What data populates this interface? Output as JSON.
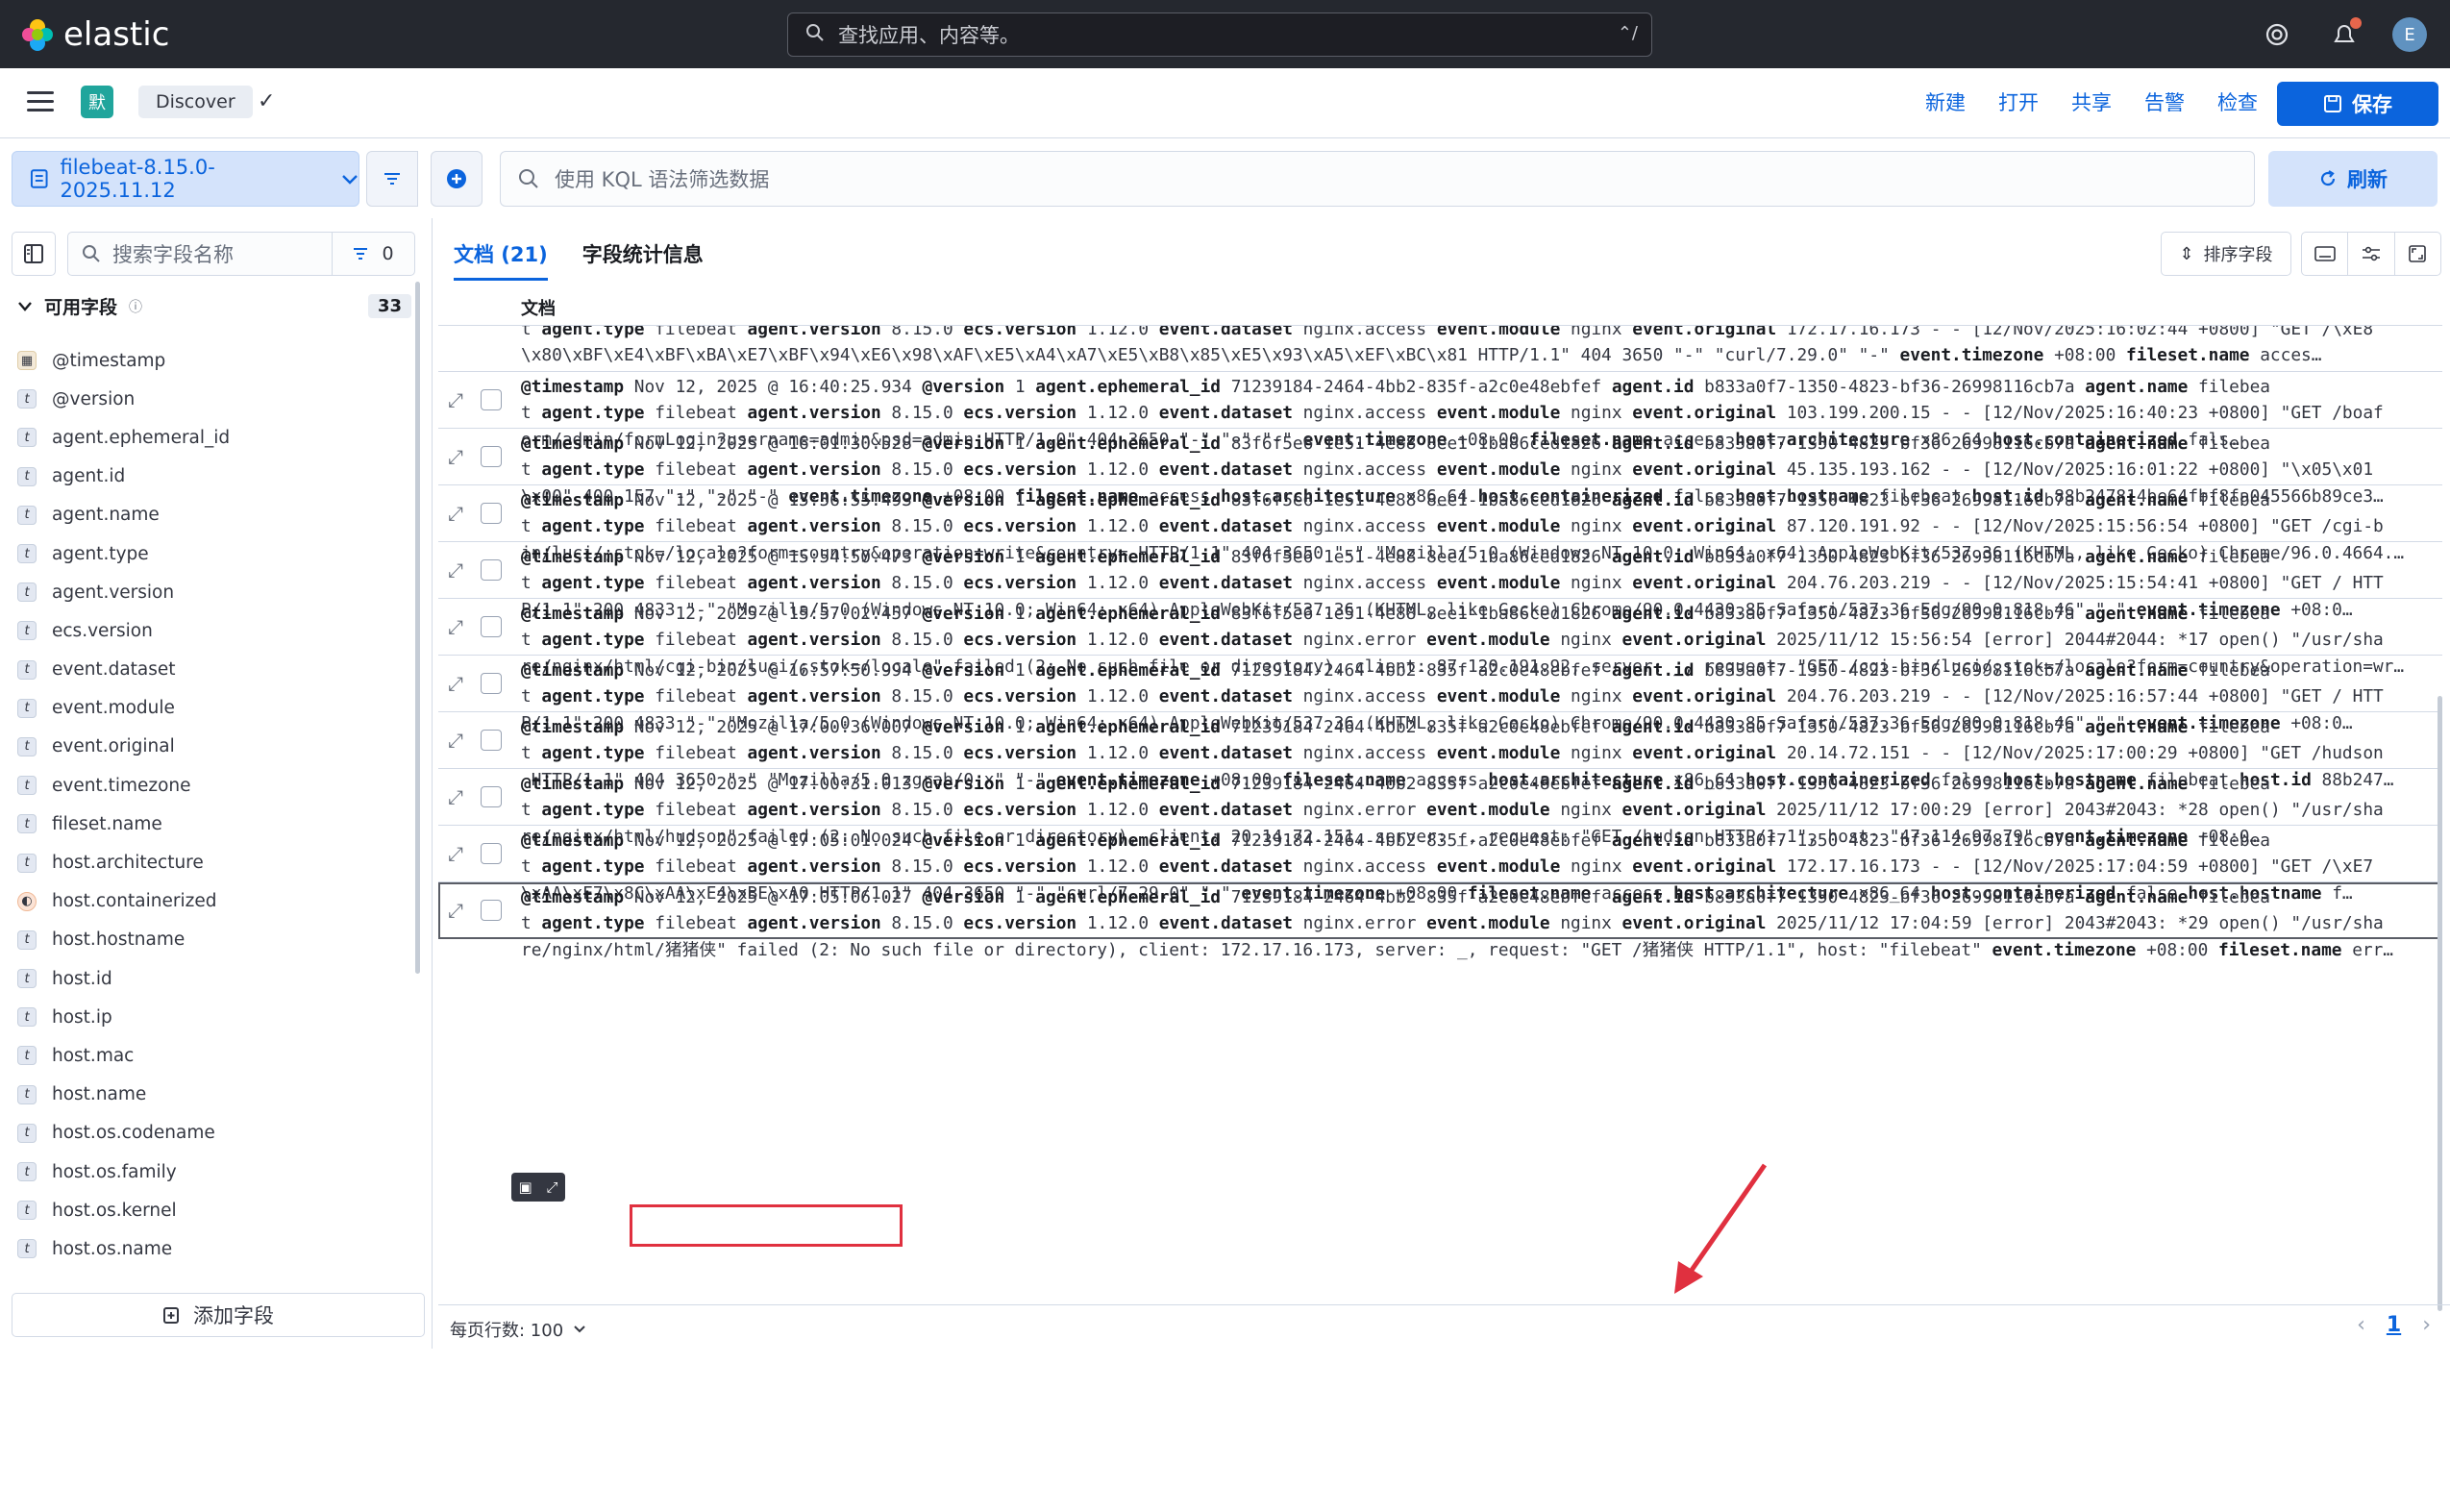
{
  "app": {
    "brand": "elastic",
    "search_placeholder": "查找应用、内容等。",
    "search_shortcut": "⌃/",
    "user_initial": "E"
  },
  "nav": {
    "space_initial": "默",
    "breadcrumb": "Discover",
    "links": [
      "新建",
      "打开",
      "共享",
      "告警",
      "检查"
    ],
    "save_label": "保存"
  },
  "toolbar": {
    "data_view": "filebeat-8.15.0-2025.11.12",
    "kql_placeholder": "使用 KQL 语法筛选数据",
    "refresh_label": "刷新"
  },
  "sidebar": {
    "search_placeholder": "搜索字段名称",
    "filter_count": "0",
    "available_label": "可用字段",
    "available_count": "33",
    "add_field_label": "添加字段",
    "fields": [
      {
        "name": "@timestamp",
        "type": "date"
      },
      {
        "name": "@version",
        "type": "t"
      },
      {
        "name": "agent.ephemeral_id",
        "type": "t"
      },
      {
        "name": "agent.id",
        "type": "t"
      },
      {
        "name": "agent.name",
        "type": "t"
      },
      {
        "name": "agent.type",
        "type": "t"
      },
      {
        "name": "agent.version",
        "type": "t"
      },
      {
        "name": "ecs.version",
        "type": "t"
      },
      {
        "name": "event.dataset",
        "type": "t"
      },
      {
        "name": "event.module",
        "type": "t"
      },
      {
        "name": "event.original",
        "type": "t"
      },
      {
        "name": "event.timezone",
        "type": "t"
      },
      {
        "name": "fileset.name",
        "type": "t"
      },
      {
        "name": "host.architecture",
        "type": "t"
      },
      {
        "name": "host.containerized",
        "type": "bool"
      },
      {
        "name": "host.hostname",
        "type": "t"
      },
      {
        "name": "host.id",
        "type": "t"
      },
      {
        "name": "host.ip",
        "type": "t"
      },
      {
        "name": "host.mac",
        "type": "t"
      },
      {
        "name": "host.name",
        "type": "t"
      },
      {
        "name": "host.os.codename",
        "type": "t"
      },
      {
        "name": "host.os.family",
        "type": "t"
      },
      {
        "name": "host.os.kernel",
        "type": "t"
      },
      {
        "name": "host.os.name",
        "type": "t"
      }
    ]
  },
  "main": {
    "tabs": [
      "文档 (21)",
      "字段统计信息"
    ],
    "sort_label": "排序字段",
    "column_header": "文档",
    "rows_per_page": "每页行数: 100",
    "current_page": "1",
    "partial_row": [
      "t agent.type filebeat agent.version 8.15.0 ecs.version 1.12.0 event.dataset nginx.access event.module nginx event.original 172.17.16.173 - - [12/Nov/2025:16:02:44 +0800] \"GET /\\xE8",
      "\\x80\\xBF\\xE4\\xBF\\xBA\\xE7\\xBF\\x94\\xE6\\x98\\xAF\\xE5\\xA4\\xA7\\xE5\\xB8\\x85\\xE5\\x93\\xA5\\xEF\\xBC\\x81 HTTP/1.1\" 404 3650 \"-\" \"curl/7.29.0\" \"-\" event.timezone +08:00 fileset.name acces…"
    ],
    "rows": [
      {
        "ts": "Nov 12, 2025 @ 16:40:25.934",
        "eph": "71239184-2464-4bb2-835f-a2c0e48ebfef",
        "ds": "nginx.access",
        "l2": "103.199.200.15 - - [12/Nov/2025:16:40:23 +0800] \"GET /boaf",
        "l3": "orm/admin/formLogin?username=admin&psd=admin HTTP/1.0\" 404 3650 \"-\" \"-\" \"-\" event.timezone +08:00 fileset.name access host.architecture x86_64 host.containerized fals…"
      },
      {
        "ts": "Nov 12, 2025 @ 16:01:30.528",
        "eph": "83f6f5e6-1e51-4e88-8ee1-1ba86ced1826",
        "ds": "nginx.access",
        "l2": "45.135.193.162 - - [12/Nov/2025:16:01:22 +0800] \"\\x05\\x01",
        "l3": "\\x00\" 400 157 \"-\" \"-\" \"-\" event.timezone +08:00 fileset.name access host.architecture x86_64 host.containerized false host.hostname filebeat host.id 88b247814be64fbf8fa045566b89ce3…"
      },
      {
        "ts": "Nov 12, 2025 @ 15:56:55.493",
        "eph": "83f6f5e6-1e51-4e88-8ee1-1ba86ced1826",
        "ds": "nginx.access",
        "l2": "87.120.191.92 - - [12/Nov/2025:15:56:54 +0800] \"GET /cgi-b",
        "l3": "in/luci/;stok=/locale?form=country&operation=write&country= HTTP/1.1\" 404 3650 \"-\" \"Mozilla/5.0 (Windows NT 10.0; Win64; x64) AppleWebKit/537.36 (KHTML, like Gecko) Chrome/96.0.4664.…"
      },
      {
        "ts": "Nov 12, 2025 @ 15:54:50.473",
        "eph": "83f6f5e6-1e51-4e88-8ee1-1ba86ced1826",
        "ds": "nginx.access",
        "l2": "204.76.203.219 - - [12/Nov/2025:15:54:41 +0800] \"GET / HTT",
        "l3": "P/1.1\" 200 4833 \"-\" \"Mozilla/5.0 (Windows NT 10.0; Win64; x64) AppleWebKit/537.36 (KHTML, like Gecko) Chrome/90.0.4430.85 Safari/537.36 Edg/90.0.818.46\" \"-\" event.timezone +08:0…"
      },
      {
        "ts": "Nov 12, 2025 @ 15:57:02.457",
        "eph": "83f6f5e6-1e51-4e88-8ee1-1ba86ced1826",
        "ds": "nginx.error",
        "l2": "2025/11/12 15:56:54 [error] 2044#2044: *17 open() \"/usr/sha",
        "l3": "re/nginx/html/cgi-bin/luci/;stok=/locale\" failed (2: No such file or directory), client: 87.120.191.92, server: _, request: \"GET /cgi-bin/luci/;stok=/locale?form=country&operation=wr…"
      },
      {
        "ts": "Nov 12, 2025 @ 16:57:50.994",
        "eph": "71239184-2464-4bb2-835f-a2c0e48ebfef",
        "ds": "nginx.access",
        "l2": "204.76.203.219 - - [12/Nov/2025:16:57:44 +0800] \"GET / HTT",
        "l3": "P/1.1\" 200 4833 \"-\" \"Mozilla/5.0 (Windows NT 10.0; Win64; x64) AppleWebKit/537.36 (KHTML, like Gecko) Chrome/90.0.4430.85 Safari/537.36 Edg/90.0.818.46\" \"-\" event.timezone +08:0…"
      },
      {
        "ts": "Nov 12, 2025 @ 17:00:36.007",
        "eph": "71239184-2464-4bb2-835f-a2c0e48ebfef",
        "ds": "nginx.access",
        "l2": "20.14.72.151 - - [12/Nov/2025:17:00:29 +0800] \"GET /hudson",
        "l3": " HTTP/1.1\" 404 3650 \"-\" \"Mozilla/5.0 zgrab/0.x\" \"-\" event.timezone +08:00 fileset.name access host.architecture x86_64 host.containerized false host.hostname filebeat host.id 88b247…"
      },
      {
        "ts": "Nov 12, 2025 @ 17:00:31.013",
        "eph": "71239184-2464-4bb2-835f-a2c0e48ebfef",
        "ds": "nginx.error",
        "l2": "2025/11/12 17:00:29 [error] 2043#2043: *28 open() \"/usr/sha",
        "l3": "re/nginx/html/hudson\" failed (2: No such file or directory), client: 20.14.72.151, server: _, request: \"GET /hudson HTTP/1.1\", host: \"47.114.97.79\" event.timezone +08:0…"
      },
      {
        "ts": "Nov 12, 2025 @ 17:05:01.024",
        "eph": "71239184-2464-4bb2-835f-a2c0e48ebfef",
        "ds": "nginx.access",
        "l2": "172.17.16.173 - - [12/Nov/2025:17:04:59 +0800] \"GET /\\xE7",
        "l3": "\\xAA\\xE7\\x8C\\xAA\\xE4\\xBE\\xA0 HTTP/1.1\" 404 3650 \"-\" \"curl/7.29.0\" \"-\" event.timezone +08:00 fileset.name access host.architecture x86_64 host.containerized false host.hostname f…"
      },
      {
        "ts": "Nov 12, 2025 @ 17:05:06.027",
        "eph": "71239184-2464-4bb2-835f-a2c0e48ebfef",
        "ds": "nginx.error",
        "l2": "2025/11/12 17:04:59 [error] 2043#2043: *29 open() \"/usr/sha",
        "l3": "re/nginx/html/猪猪侠\" failed (2: No such file or directory), client: 172.17.16.173, server: _, request: \"GET /猪猪侠 HTTP/1.1\", host: \"filebeat\" event.timezone +08:00 fileset.name err…"
      }
    ],
    "shared": {
      "version": "1",
      "agent_id": "b833a0f7-1350-4823-bf36-26998116cb7a",
      "agent_name": "filebea",
      "agent_name_cont": "t",
      "agent_type": "filebeat",
      "agent_version": "8.15.0",
      "ecs_version": "1.12.0",
      "module": "nginx"
    }
  },
  "colors": {
    "accent": "#0b64dd",
    "topbar": "#25282f",
    "highlight": "#e0303f"
  }
}
